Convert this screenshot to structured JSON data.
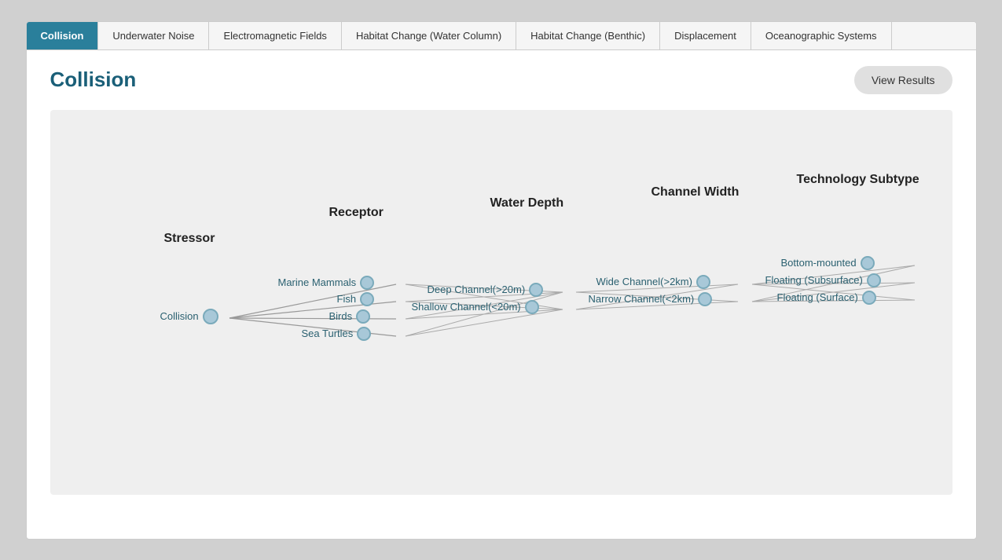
{
  "tabs": [
    {
      "id": "collision",
      "label": "Collision",
      "active": true
    },
    {
      "id": "underwater-noise",
      "label": "Underwater Noise",
      "active": false
    },
    {
      "id": "em-fields",
      "label": "Electromagnetic Fields",
      "active": false
    },
    {
      "id": "habitat-water",
      "label": "Habitat Change (Water Column)",
      "active": false
    },
    {
      "id": "habitat-benthic",
      "label": "Habitat Change (Benthic)",
      "active": false
    },
    {
      "id": "displacement",
      "label": "Displacement",
      "active": false
    },
    {
      "id": "ocean-systems",
      "label": "Oceanographic Systems",
      "active": false
    }
  ],
  "page_title": "Collision",
  "view_results_label": "View Results",
  "columns": {
    "stressor": "Stressor",
    "receptor": "Receptor",
    "water_depth": "Water Depth",
    "channel_width": "Channel Width",
    "tech_subtype": "Technology Subtype"
  },
  "stressor_node": "Collision",
  "receptors": [
    "Marine Mammals",
    "Fish",
    "Birds",
    "Sea Turtles"
  ],
  "water_depths": [
    "Deep Channel(>20m)",
    "Shallow Channel(<20m)"
  ],
  "channel_widths": [
    "Wide Channel(>2km)",
    "Narrow Channel(<2km)"
  ],
  "tech_subtypes": [
    "Bottom-mounted",
    "Floating (Subsurface)",
    "Floating (Surface)"
  ]
}
